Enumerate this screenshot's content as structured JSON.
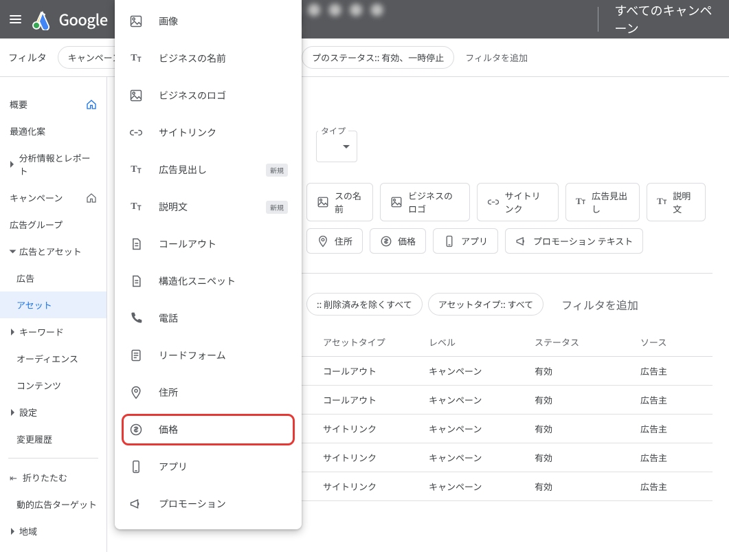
{
  "header": {
    "brand": "Google",
    "campaigns": "すべてのキャンペーン"
  },
  "filterbar": {
    "label": "フィルタ",
    "chip_campaign": "キャンペーン",
    "chip_group_status": "プのステータス:: 有効、一時停止",
    "add": "フィルタを追加"
  },
  "nav": {
    "overview": "概要",
    "recommendations": "最適化案",
    "insights": "分析情報とレポート",
    "campaigns": "キャンペーン",
    "adgroups": "広告グループ",
    "ads_assets": "広告とアセット",
    "ads": "広告",
    "assets": "アセット",
    "keywords": "キーワード",
    "audiences": "オーディエンス",
    "contents": "コンテンツ",
    "settings": "設定",
    "history": "変更履歴",
    "collapse": "折りたたむ",
    "dyn_targets": "動的広告ターゲット",
    "locations": "地域"
  },
  "assettype_label": "タイプ",
  "asset_chips": {
    "biz_name": "スの名前",
    "biz_logo": "ビジネスのロゴ",
    "sitelink": "サイトリンク",
    "headline": "広告見出し",
    "description": "説明文",
    "location": "住所",
    "price": "価格",
    "app": "アプリ",
    "promo": "プロモーション テキスト"
  },
  "dropdown": {
    "image": "画像",
    "biz_name": "ビジネスの名前",
    "biz_logo": "ビジネスのロゴ",
    "sitelink": "サイトリンク",
    "headline": "広告見出し",
    "description": "説明文",
    "callout": "コールアウト",
    "snippet": "構造化スニペット",
    "call": "電話",
    "leadform": "リードフォーム",
    "location": "住所",
    "price": "価格",
    "app": "アプリ",
    "promo": "プロモーション",
    "badge_new": "新規"
  },
  "table_filters": {
    "chip_status": ":: 削除済みを除くすべて",
    "chip_type": "アセットタイプ:: すべて",
    "add": "フィルタを追加"
  },
  "table": {
    "head": {
      "c1": "",
      "c2": "アセットタイプ",
      "c3": "レベル",
      "c4": "ステータス",
      "c5": "ソース"
    },
    "rows": [
      {
        "c2": "コールアウト",
        "c3": "キャンペーン",
        "c4": "有効",
        "c5": "広告主"
      },
      {
        "c2": "コールアウト",
        "c3": "キャンペーン",
        "c4": "有効",
        "c5": "広告主"
      },
      {
        "c2": "サイトリンク",
        "c3": "キャンペーン",
        "c4": "有効",
        "c5": "広告主"
      },
      {
        "c2": "サイトリンク",
        "c3": "キャンペーン",
        "c4": "有効",
        "c5": "広告主"
      },
      {
        "c2": "サイトリンク",
        "c3": "キャンペーン",
        "c4": "有効",
        "c5": "広告主"
      }
    ]
  }
}
